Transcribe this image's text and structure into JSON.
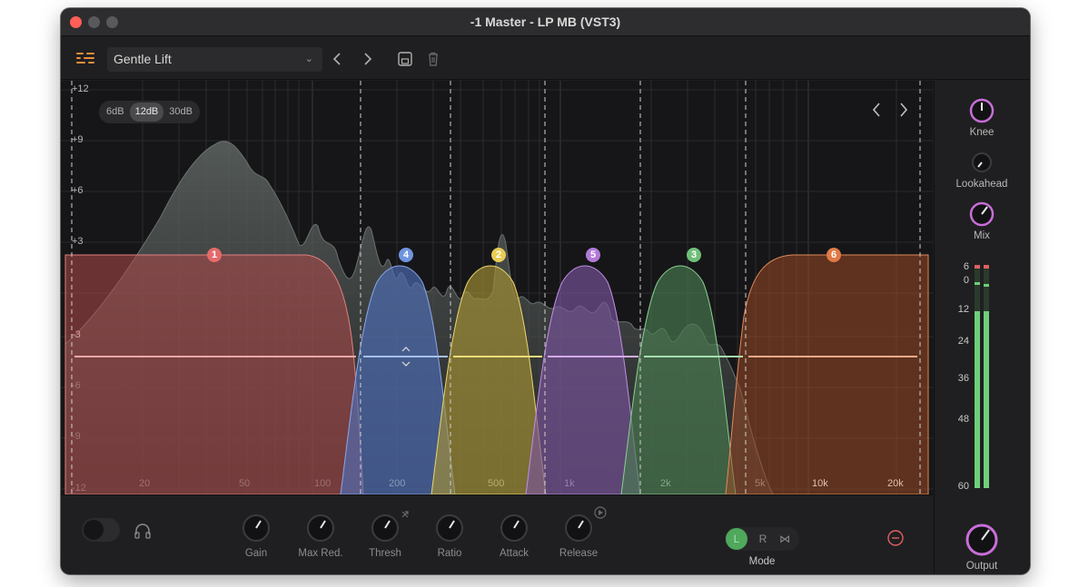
{
  "window": {
    "title": "-1 Master - LP MB (VST3)"
  },
  "toolbar": {
    "preset_name": "Gentle Lift",
    "prev_icon": "chevron-left-icon",
    "next_icon": "chevron-right-icon",
    "save_icon": "save-icon",
    "delete_icon": "trash-icon"
  },
  "range_selector": {
    "options": [
      "6dB",
      "12dB",
      "30dB"
    ],
    "selected": "12dB"
  },
  "graph": {
    "db_labels": [
      "+12",
      "+9",
      "+6",
      "+3",
      "-3",
      "-6",
      "-9",
      "-12"
    ],
    "freq_labels": [
      "20",
      "50",
      "100",
      "200",
      "500",
      "1k",
      "2k",
      "5k",
      "10k",
      "20k"
    ],
    "bands": [
      {
        "label": "1",
        "color": "#e46a6a"
      },
      {
        "label": "4",
        "color": "#6f94e0"
      },
      {
        "label": "2",
        "color": "#e8cc54"
      },
      {
        "label": "5",
        "color": "#b27ad8"
      },
      {
        "label": "3",
        "color": "#6fbf78"
      },
      {
        "label": "6",
        "color": "#e07a46"
      }
    ]
  },
  "controls": {
    "knobs": [
      "Gain",
      "Max Red.",
      "Thresh",
      "Ratio",
      "Attack",
      "Release"
    ],
    "mode_options": [
      "L",
      "R",
      "⋈"
    ],
    "mode_selected": "L",
    "mode_label": "Mode"
  },
  "side": {
    "knee_label": "Knee",
    "lookahead_label": "Lookahead",
    "mix_label": "Mix",
    "output_label": "Output",
    "meter_ticks": [
      "6",
      "0",
      "12",
      "24",
      "36",
      "48",
      "60"
    ],
    "meter_color": "#6fcf7a",
    "accent": "#c86ed8"
  }
}
